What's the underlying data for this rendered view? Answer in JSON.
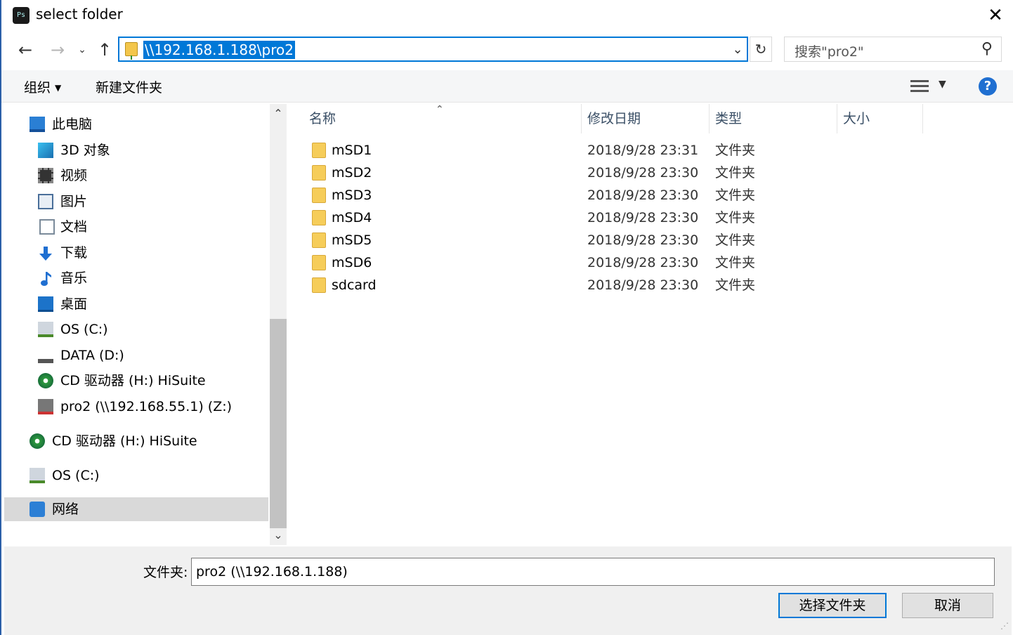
{
  "window": {
    "title": "select folder",
    "app_icon_text": "Ps",
    "close_glyph": "✕"
  },
  "nav": {
    "back_glyph": "←",
    "forward_glyph": "→",
    "history_glyph": "⌄",
    "up_glyph": "↑",
    "address": "\\\\192.168.1.188\\pro2",
    "address_drop_glyph": "⌄",
    "refresh_glyph": "↻",
    "search_placeholder": "搜索\"pro2\"",
    "search_glyph": "⚲"
  },
  "toolbar": {
    "organize_label": "组织",
    "organize_caret": "▼",
    "new_folder_label": "新建文件夹",
    "view_caret": "▼",
    "help_glyph": "?"
  },
  "sidebar": {
    "items": [
      {
        "label": "此电脑",
        "icon": "computer-icon"
      },
      {
        "label": "3D 对象",
        "icon": "3d-objects-icon"
      },
      {
        "label": "视频",
        "icon": "video-icon"
      },
      {
        "label": "图片",
        "icon": "pictures-icon"
      },
      {
        "label": "文档",
        "icon": "documents-icon"
      },
      {
        "label": "下载",
        "icon": "download-icon"
      },
      {
        "label": "音乐",
        "icon": "music-icon"
      },
      {
        "label": "桌面",
        "icon": "desktop-icon"
      },
      {
        "label": "OS (C:)",
        "icon": "os-drive-icon"
      },
      {
        "label": "DATA (D:)",
        "icon": "data-drive-icon"
      },
      {
        "label": "CD 驱动器 (H:) HiSuite",
        "icon": "cd-drive-icon"
      },
      {
        "label": "pro2 (\\\\192.168.55.1) (Z:)",
        "icon": "network-drive-icon"
      },
      {
        "label": "CD 驱动器 (H:) HiSuite",
        "icon": "cd-drive-icon"
      },
      {
        "label": "OS (C:)",
        "icon": "os-drive-icon"
      },
      {
        "label": "网络",
        "icon": "network-icon",
        "selected": true
      }
    ],
    "scroll_up_glyph": "⌃",
    "scroll_down_glyph": "⌄"
  },
  "filelist": {
    "sort_glyph": "⌃",
    "columns": [
      "名称",
      "修改日期",
      "类型",
      "大小"
    ],
    "rows": [
      {
        "name": "mSD1",
        "date": "2018/9/28 23:31",
        "type": "文件夹"
      },
      {
        "name": "mSD2",
        "date": "2018/9/28 23:30",
        "type": "文件夹"
      },
      {
        "name": "mSD3",
        "date": "2018/9/28 23:30",
        "type": "文件夹"
      },
      {
        "name": "mSD4",
        "date": "2018/9/28 23:30",
        "type": "文件夹"
      },
      {
        "name": "mSD5",
        "date": "2018/9/28 23:30",
        "type": "文件夹"
      },
      {
        "name": "mSD6",
        "date": "2018/9/28 23:30",
        "type": "文件夹"
      },
      {
        "name": "sdcard",
        "date": "2018/9/28 23:30",
        "type": "文件夹"
      }
    ]
  },
  "footer": {
    "folder_label": "文件夹:",
    "folder_value": "pro2 (\\\\192.168.1.188)",
    "select_button": "选择文件夹",
    "cancel_button": "取消"
  },
  "colors": {
    "accent": "#0078d7",
    "folder": "#f6cd5a",
    "selected_row": "#d9d9d9"
  }
}
